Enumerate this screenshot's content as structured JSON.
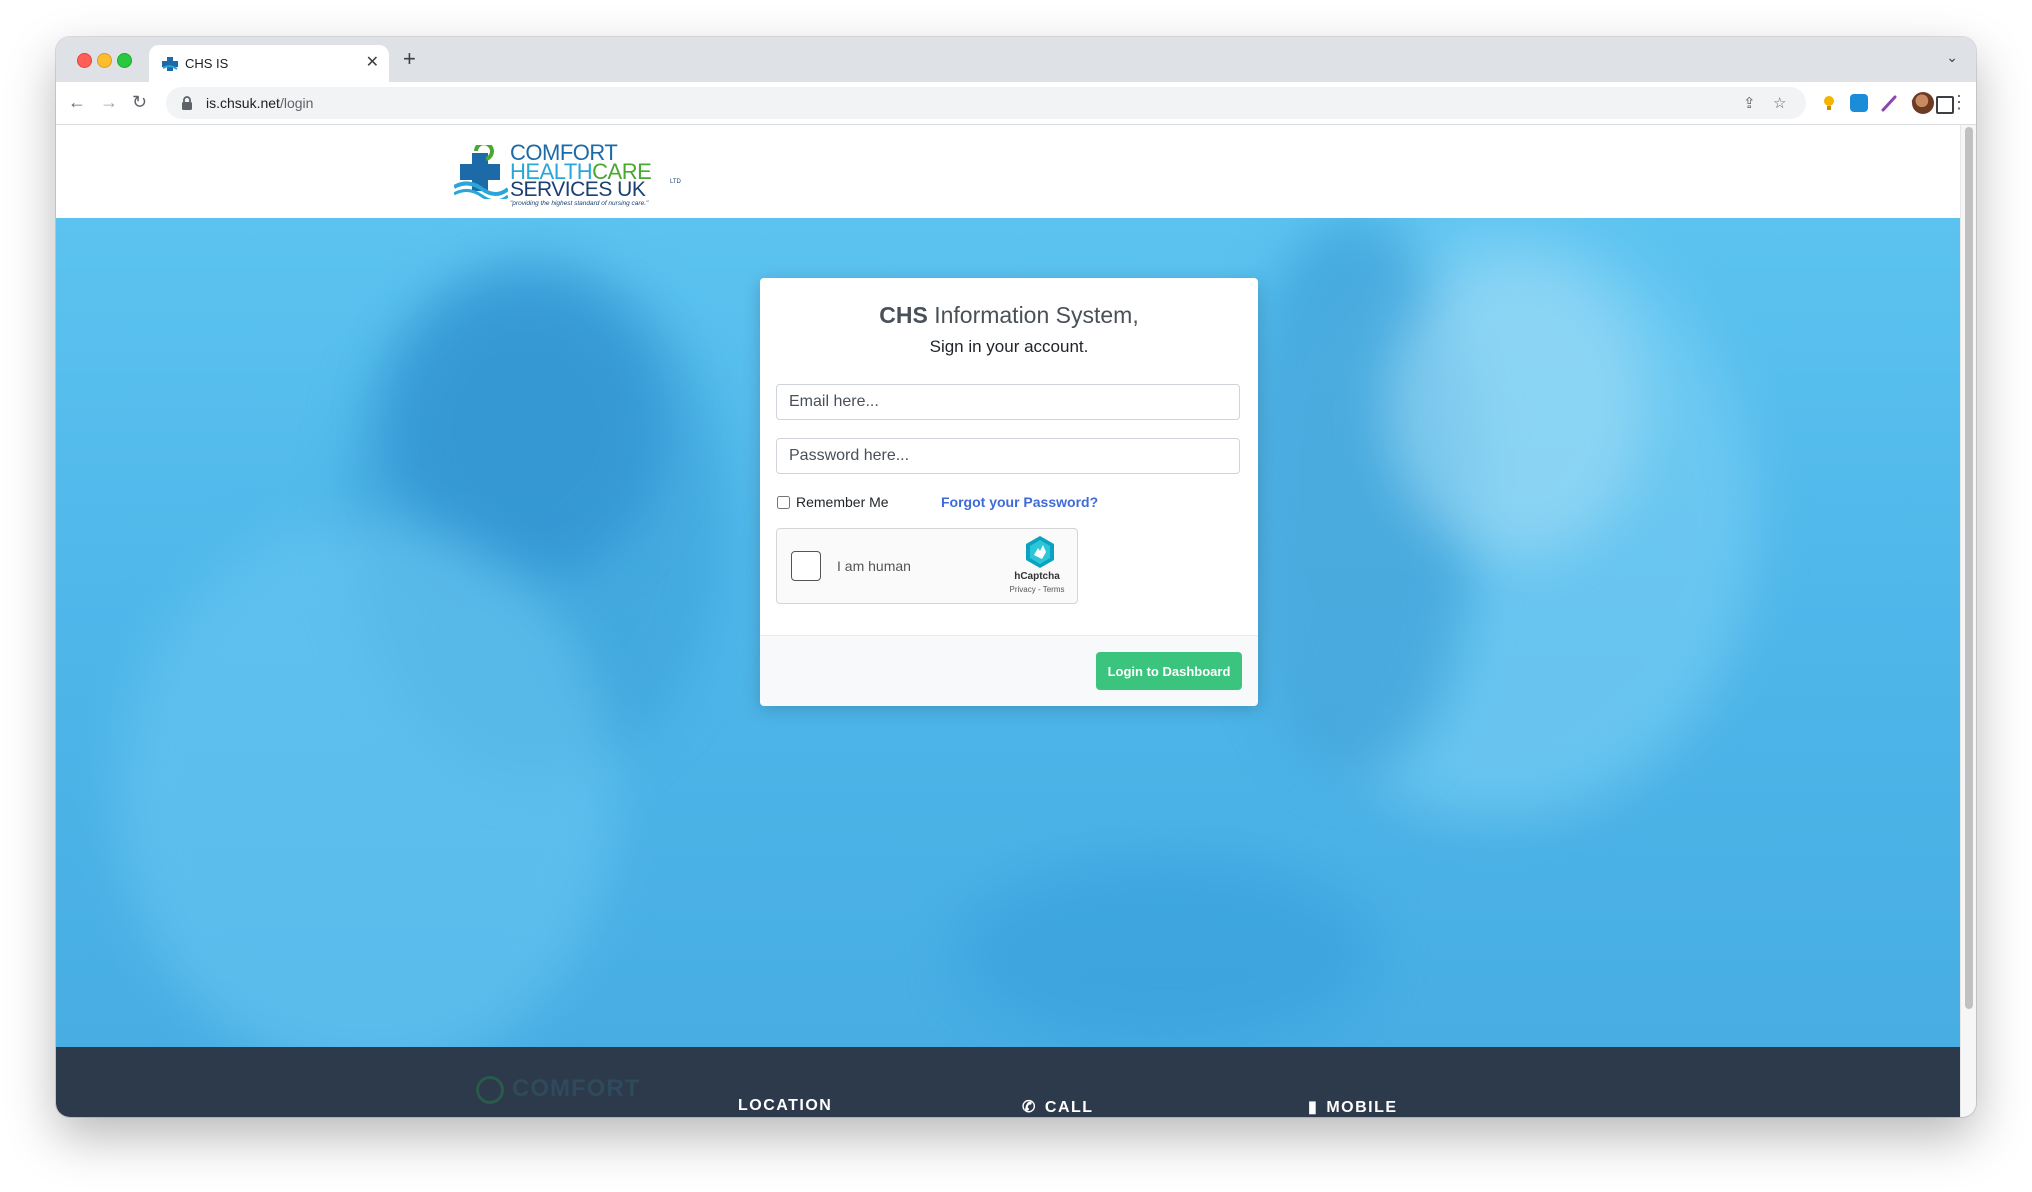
{
  "browser": {
    "tab_title": "CHS IS",
    "url_host": "is.chsuk.net",
    "url_path": "/login"
  },
  "logo": {
    "line1": "COMFORT",
    "line2a": "HEALTH",
    "line2b": "CARE",
    "line3": "SERVICES UK",
    "ltd": "LTD",
    "tagline": "\"providing the highest standard of nursing care.\""
  },
  "login": {
    "title_bold": "CHS",
    "title_rest": " Information System,",
    "subtitle": "Sign in your account.",
    "email_placeholder": "Email here...",
    "password_placeholder": "Password here...",
    "remember_label": "Remember Me",
    "forgot_link": "Forgot your Password?",
    "captcha_label": "I am human",
    "captcha_brand": "hCaptcha",
    "captcha_links": "Privacy - Terms",
    "submit_label": "Login to Dashboard"
  },
  "footer": {
    "logo_text": "COMFORT",
    "location_heading": "LOCATION",
    "call_heading": "CALL",
    "mobile_heading": "MOBILE"
  },
  "colors": {
    "accent_green": "#3ac47d",
    "link_blue": "#3f6ad8",
    "hero_blue": "#4fb7ea",
    "footer_dark": "#2c3a4b"
  }
}
